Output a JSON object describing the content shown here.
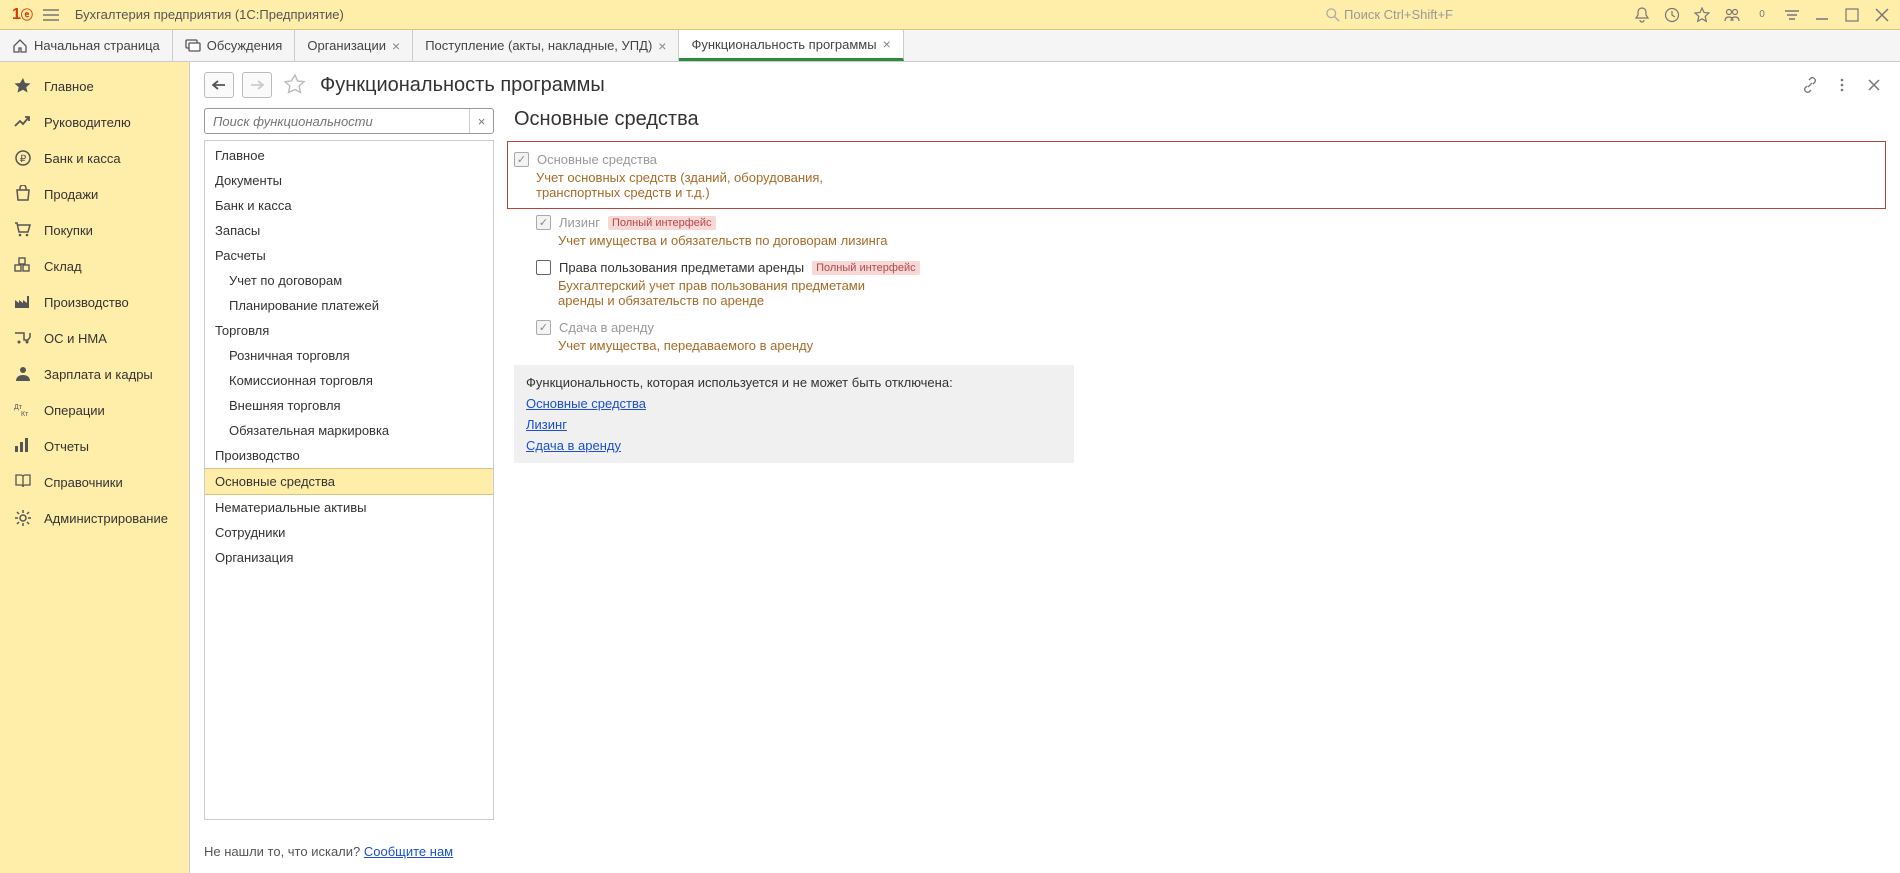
{
  "titlebar": {
    "app_title": "Бухгалтерия предприятия  (1С:Предприятие)",
    "search_placeholder": "Поиск Ctrl+Shift+F"
  },
  "tabs": [
    {
      "label": "Начальная страница",
      "icon": "home",
      "closable": false
    },
    {
      "label": "Обсуждения",
      "icon": "chat",
      "closable": false
    },
    {
      "label": "Организации",
      "closable": true
    },
    {
      "label": "Поступление (акты, накладные, УПД)",
      "closable": true
    },
    {
      "label": "Функциональность программы",
      "closable": true,
      "active": true
    }
  ],
  "sidebar": [
    {
      "icon": "star",
      "label": "Главное"
    },
    {
      "icon": "trend",
      "label": "Руководителю"
    },
    {
      "icon": "ruble",
      "label": "Банк и касса"
    },
    {
      "icon": "bag",
      "label": "Продажи"
    },
    {
      "icon": "cart",
      "label": "Покупки"
    },
    {
      "icon": "boxes",
      "label": "Склад"
    },
    {
      "icon": "factory",
      "label": "Производство"
    },
    {
      "icon": "truck",
      "label": "ОС и НМА"
    },
    {
      "icon": "person",
      "label": "Зарплата и кадры"
    },
    {
      "icon": "dtkt",
      "label": "Операции"
    },
    {
      "icon": "bars",
      "label": "Отчеты"
    },
    {
      "icon": "book",
      "label": "Справочники"
    },
    {
      "icon": "gear",
      "label": "Администрирование"
    }
  ],
  "page": {
    "title": "Функциональность программы",
    "search_placeholder": "Поиск функциональности",
    "nav_items": [
      {
        "label": "Главное"
      },
      {
        "label": "Документы"
      },
      {
        "label": "Банк и касса"
      },
      {
        "label": "Запасы"
      },
      {
        "label": "Расчеты"
      },
      {
        "label": "Учет по договорам",
        "sub": true
      },
      {
        "label": "Планирование платежей",
        "sub": true
      },
      {
        "label": "Торговля"
      },
      {
        "label": "Розничная торговля",
        "sub": true
      },
      {
        "label": "Комиссионная торговля",
        "sub": true
      },
      {
        "label": "Внешняя торговля",
        "sub": true
      },
      {
        "label": "Обязательная маркировка",
        "sub": true
      },
      {
        "label": "Производство"
      },
      {
        "label": "Основные средства",
        "selected": true
      },
      {
        "label": "Нематериальные активы"
      },
      {
        "label": "Сотрудники"
      },
      {
        "label": "Организация"
      }
    ],
    "detail": {
      "title": "Основные средства",
      "options": [
        {
          "label": "Основные средства",
          "checked": true,
          "disabled": true,
          "desc": "Учет основных средств (зданий, оборудования, транспортных средств и т.д.)",
          "highlighted": true,
          "indent": 0
        },
        {
          "label": "Лизинг",
          "checked": true,
          "disabled": true,
          "badge": "Полный интерфейс",
          "desc": "Учет имущества и обязательств по договорам лизинга",
          "indent": 1
        },
        {
          "label": "Права пользования предметами аренды",
          "checked": false,
          "disabled": false,
          "badge": "Полный интерфейс",
          "desc": "Бухгалтерский учет прав пользования предметами аренды и обязательств по аренде",
          "indent": 1
        },
        {
          "label": "Сдача в аренду",
          "checked": true,
          "disabled": true,
          "desc": "Учет имущества, передаваемого в аренду",
          "indent": 1
        }
      ],
      "info_title": "Функциональность, которая используется и не может быть отключена:",
      "info_links": [
        "Основные средства",
        "Лизинг",
        "Сдача в аренду"
      ]
    },
    "footer_text": "Не нашли то, что искали?  ",
    "footer_link": "Сообщите нам"
  }
}
